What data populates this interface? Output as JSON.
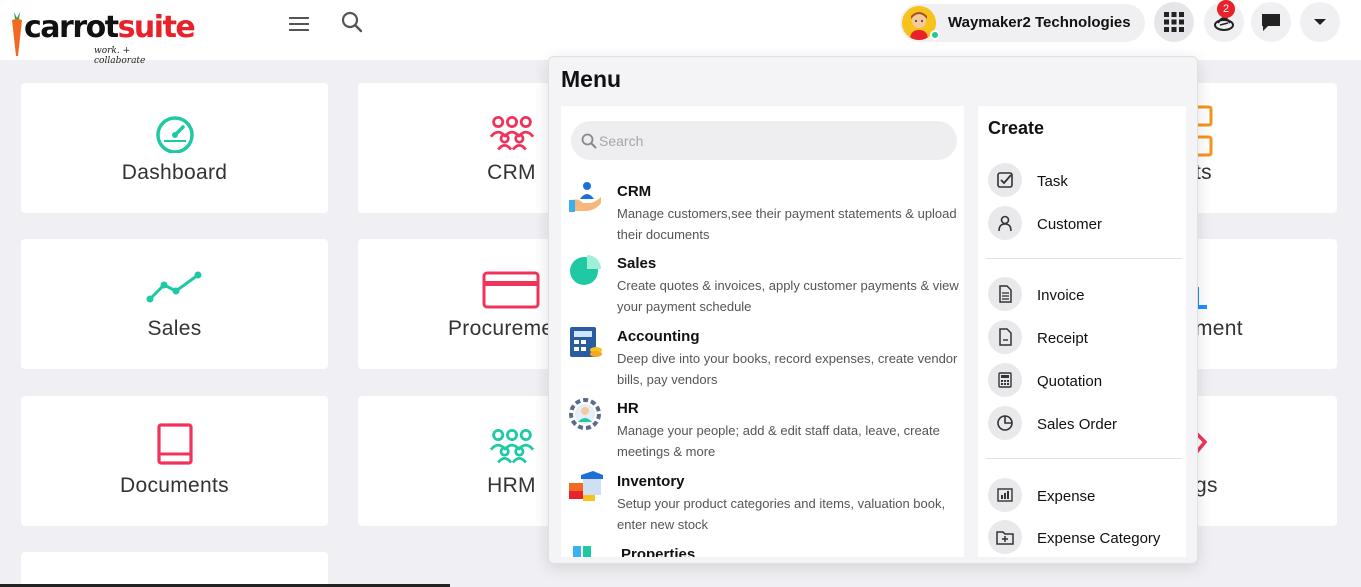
{
  "header": {
    "logo_main": "carrot",
    "logo_suite": "suite",
    "logo_tagline": "work. + collaborate",
    "org_name": "Waymaker2 Technologies",
    "notification_count": "2"
  },
  "modules": [
    {
      "label": "Dashboard",
      "icon": "speedometer-icon",
      "color": "#1ec9a4"
    },
    {
      "label": "CRM",
      "icon": "people-group-icon",
      "color": "#f1335c"
    },
    {
      "label": "ts",
      "icon": "grid-boxes-icon",
      "color": "#f7931e"
    },
    {
      "label": "Sales",
      "icon": "trend-line-icon",
      "color": "#1ec9a4"
    },
    {
      "label": "Procureme",
      "icon": "credit-card-icon",
      "color": "#f1335c"
    },
    {
      "label": "ment",
      "icon": "bar-icon",
      "color": "#1e90ff"
    },
    {
      "label": "Documents",
      "icon": "book-icon",
      "color": "#f1335c"
    },
    {
      "label": "HRM",
      "icon": "people-group-icon",
      "color": "#1ec9a4"
    },
    {
      "label": "gs",
      "icon": "settings-icon",
      "color": "#f1335c"
    }
  ],
  "menu": {
    "title": "Menu",
    "search_placeholder": "Search",
    "items": [
      {
        "name": "CRM",
        "desc": "Manage customers,see their payment statements & upload their documents"
      },
      {
        "name": "Sales",
        "desc": "Create quotes & invoices, apply customer payments & view your payment schedule"
      },
      {
        "name": "Accounting",
        "desc": "Deep dive into your books, record expenses, create vendor bills, pay vendors"
      },
      {
        "name": "HR",
        "desc": "Manage your people; add & edit staff data, leave, create meetings & more"
      },
      {
        "name": "Inventory",
        "desc": "Setup your product categories and items, valuation book, enter new stock"
      },
      {
        "name": "Properties",
        "desc": ""
      }
    ]
  },
  "create": {
    "title": "Create",
    "items": [
      {
        "label": "Task",
        "icon": "checkbox-icon"
      },
      {
        "label": "Customer",
        "icon": "person-icon"
      },
      {
        "label": "Invoice",
        "icon": "document-icon"
      },
      {
        "label": "Receipt",
        "icon": "receipt-icon"
      },
      {
        "label": "Quotation",
        "icon": "calculator-icon"
      },
      {
        "label": "Sales Order",
        "icon": "pie-chart-icon"
      },
      {
        "label": "Expense",
        "icon": "expense-chart-icon"
      },
      {
        "label": "Expense Category",
        "icon": "folder-plus-icon"
      }
    ]
  }
}
